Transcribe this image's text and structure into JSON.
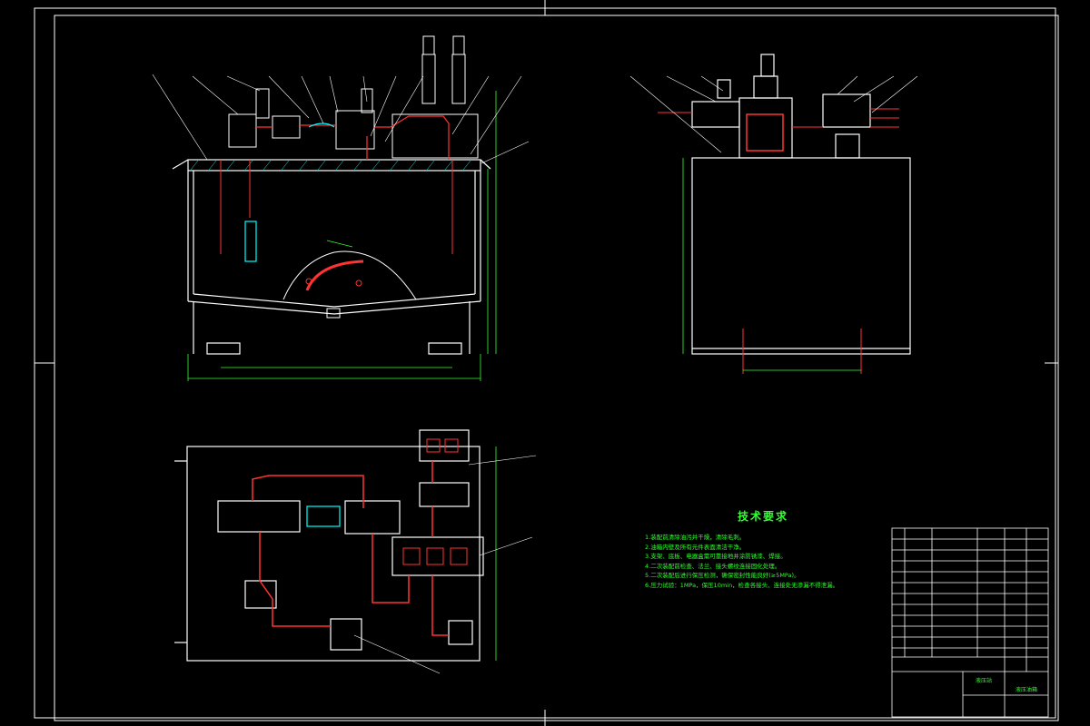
{
  "colors": {
    "background": "#000000",
    "outline": "#ffffff",
    "pipe": "#ff3333",
    "dimension": "#33ff33",
    "leader": "#ffffff",
    "accent_yellow": "#ffff00",
    "accent_cyan": "#00ffff"
  },
  "tech_requirements": {
    "title": "技术要求",
    "lines": [
      "1.装配前清除油污并干燥，清除毛刺。",
      "2.油箱内壁及所有元件表面清洁干净。",
      "3.支架、底板、电器盒需可靠接地并涂防锈漆、焊接。",
      "4.二次装配前检查、法兰、接头螺纹连接固化处理。",
      "5.二次装配后进行保压检测，确保密封性能良好(≥5MPa)。",
      "6.压力试验：1MPa，保压10min，检查各接头、连接处无渗漏不得泄漏。"
    ]
  },
  "title_block": {
    "drawing_name": "液压油箱",
    "company": "液压站"
  }
}
